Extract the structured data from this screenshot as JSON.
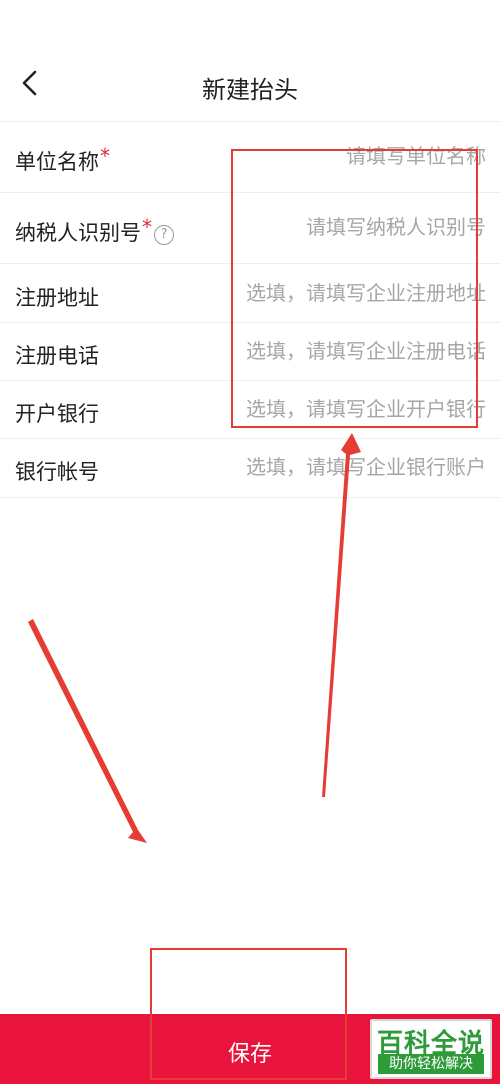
{
  "header": {
    "title": "新建抬头",
    "back_icon": "chevron-left-icon"
  },
  "form": {
    "fields": [
      {
        "label": "单位名称",
        "required": "*",
        "placeholder": "请填写单位名称",
        "value": ""
      },
      {
        "label": "纳税人识别号",
        "required": "*",
        "help": "?",
        "placeholder": "请填写纳税人识别号",
        "value": ""
      },
      {
        "label": "注册地址",
        "placeholder": "选填，请填写企业注册地址",
        "value": ""
      },
      {
        "label": "注册电话",
        "placeholder": "选填，请填写企业注册电话",
        "value": ""
      },
      {
        "label": "开户银行",
        "placeholder": "选填，请填写企业开户银行",
        "value": ""
      },
      {
        "label": "银行帐号",
        "placeholder": "选填，请填写企业银行账户",
        "value": ""
      }
    ]
  },
  "footer": {
    "save_label": "保存"
  },
  "watermark": {
    "title": "百科全说",
    "subtitle": "助你轻松解决"
  },
  "colors": {
    "accent": "#e8143c",
    "annotation": "#e53d33",
    "placeholder": "#a6a6a6",
    "divider": "#eeeeee",
    "watermark_green": "#2e9b3a"
  }
}
